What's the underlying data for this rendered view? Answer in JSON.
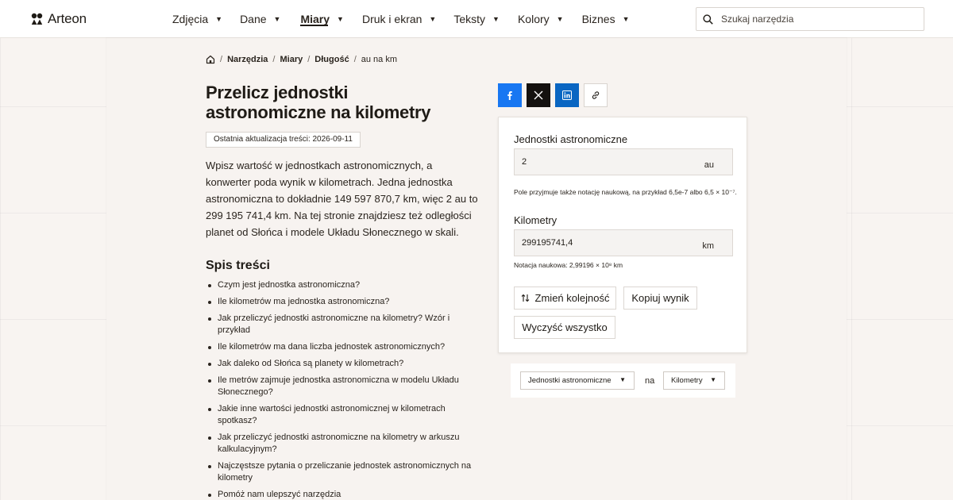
{
  "brand": {
    "name": "Arteon"
  },
  "nav": {
    "items": [
      {
        "label": "Zdjęcia",
        "active": false
      },
      {
        "label": "Dane",
        "active": false
      },
      {
        "label": "Miary",
        "active": true
      },
      {
        "label": "Druk i ekran",
        "active": false
      },
      {
        "label": "Teksty",
        "active": false
      },
      {
        "label": "Kolory",
        "active": false
      },
      {
        "label": "Biznes",
        "active": false
      }
    ],
    "caret": "▼"
  },
  "search": {
    "placeholder": "Szukaj narzędzia",
    "value": ""
  },
  "breadcrumb": {
    "items": [
      "Narzędzia",
      "Miary",
      "Długość"
    ],
    "current": "au na km",
    "separator": "/"
  },
  "page": {
    "title": "Przelicz jednostki astronomiczne na kilometry",
    "updated": "Ostatnia aktualizacja treści: 2026-09-11",
    "intro": "Wpisz wartość w jednostkach astronomicznych, a konwerter poda wynik w kilometrach. Jedna jednostka astronomiczna to dokładnie 149 597 870,7 km, więc 2 au to 299 195 741,4 km. Na tej stronie znajdziesz też odległości planet od Słońca i modele Układu Słonecznego w skali."
  },
  "toc": {
    "title": "Spis treści",
    "items": [
      "Czym jest jednostka astronomiczna?",
      "Ile kilometrów ma jednostka astronomiczna?",
      "Jak przeliczyć jednostki astronomiczne na kilometry? Wzór i przykład",
      "Ile kilometrów ma dana liczba jednostek astronomicznych?",
      "Jak daleko od Słońca są planety w kilometrach?",
      "Ile metrów zajmuje jednostka astronomiczna w modelu Układu Słonecznego?",
      "Jakie inne wartości jednostki astronomicznej w kilometrach spotkasz?",
      "Jak przeliczyć jednostki astronomiczne na kilometry w arkuszu kalkulacyjnym?",
      "Najczęstsze pytania o przeliczanie jednostek astronomicznych na kilometry",
      "Pomóż nam ulepszyć narzędzia"
    ]
  },
  "share": {
    "facebook_icon": "facebook-icon",
    "x_icon": "x-icon",
    "linkedin_icon": "linkedin-icon",
    "link_icon": "link-icon",
    "colors": {
      "facebook": "#1877f2",
      "x": "#14110f",
      "linkedin": "#0a66c2"
    }
  },
  "converter": {
    "from_label": "Jednostki astronomiczne",
    "from_value": "2",
    "from_unit": "au",
    "from_hint": "Pole przyjmuje także notację naukową, na przykład 6,5e-7 albo 6,5 × 10⁻⁷.",
    "to_label": "Kilometry",
    "to_value": "299195741,4",
    "to_unit": "km",
    "to_hint": "Notacja naukowa: 2,99196 × 10⁸ km",
    "swap_label": "Zmień kolejność",
    "copy_label": "Kopiuj wynik",
    "clear_label": "Wyczyść wszystko"
  },
  "switcher": {
    "from_unit": "Jednostki astronomiczne",
    "connector": "na",
    "to_unit": "Kilometry",
    "caret": "▼"
  }
}
